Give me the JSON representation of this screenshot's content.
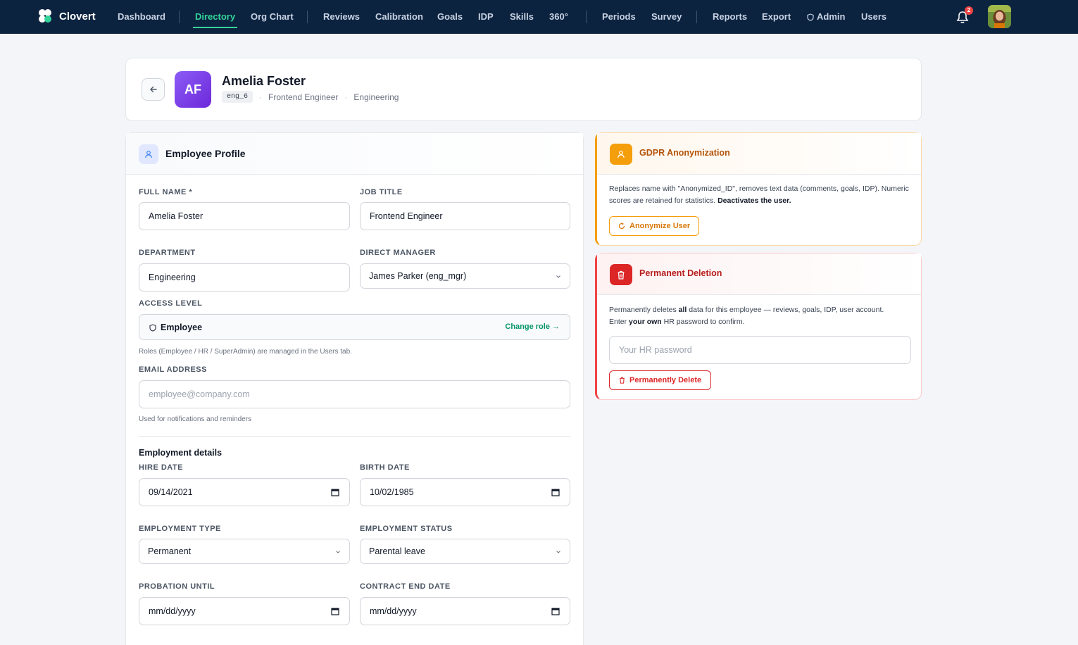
{
  "app": {
    "name": "Clovert"
  },
  "nav": {
    "items": [
      "Dashboard",
      "Directory",
      "Org Chart",
      "Reviews",
      "Calibration",
      "Goals",
      "IDP",
      "Skills",
      "360°",
      "Periods",
      "Survey",
      "Reports",
      "Export",
      "Admin",
      "Users"
    ],
    "active": "Directory",
    "notification_count": "2"
  },
  "profile": {
    "initials": "AF",
    "name": "Amelia Foster",
    "username": "eng_6",
    "title": "Frontend Engineer",
    "department": "Engineering"
  },
  "employee_profile": {
    "heading": "Employee Profile",
    "full_name_label": "FULL NAME *",
    "full_name": "Amelia Foster",
    "job_title_label": "JOB TITLE",
    "job_title": "Frontend Engineer",
    "department_label": "DEPARTMENT",
    "department": "Engineering",
    "manager_label": "DIRECT MANAGER",
    "manager": "James Parker (eng_mgr)",
    "access_label": "ACCESS LEVEL",
    "access_value": "Employee",
    "change_role": "Change role →",
    "access_hint": "Roles (Employee / HR / SuperAdmin) are managed in the Users tab.",
    "email_label": "EMAIL ADDRESS",
    "email_placeholder": "employee@company.com",
    "email_hint": "Used for notifications and reminders",
    "employment_heading": "Employment details",
    "hire_label": "HIRE DATE",
    "hire_date": "09/14/2021",
    "birth_label": "BIRTH DATE",
    "birth_date": "10/02/1985",
    "type_label": "EMPLOYMENT TYPE",
    "type_value": "Permanent",
    "status_label": "EMPLOYMENT STATUS",
    "status_value": "Parental leave",
    "probation_label": "PROBATION UNTIL",
    "probation_value": "mm/dd/yyyy",
    "contract_label": "CONTRACT END DATE",
    "contract_value": "mm/dd/yyyy"
  },
  "gdpr": {
    "heading": "GDPR Anonymization",
    "text": "Replaces name with \"Anonymized_ID\", removes text data (comments, goals, IDP). Numeric scores are retained for statistics.",
    "text_bold": "Deactivates the user.",
    "button": "Anonymize User"
  },
  "deletion": {
    "heading": "Permanent Deletion",
    "text_1": "Permanently deletes",
    "text_bold_1": "all",
    "text_2": "data for this employee — reviews, goals, IDP, user account.",
    "text_3": "Enter",
    "text_bold_2": "your own",
    "text_4": "HR password to confirm.",
    "password_placeholder": "Your HR password",
    "button": "Permanently Delete"
  },
  "colors": {
    "nav_bg": "#0c2340",
    "accent": "#34d399",
    "gdpr": "#d97706",
    "danger": "#dc2626",
    "avatar": "#7c3aed"
  }
}
